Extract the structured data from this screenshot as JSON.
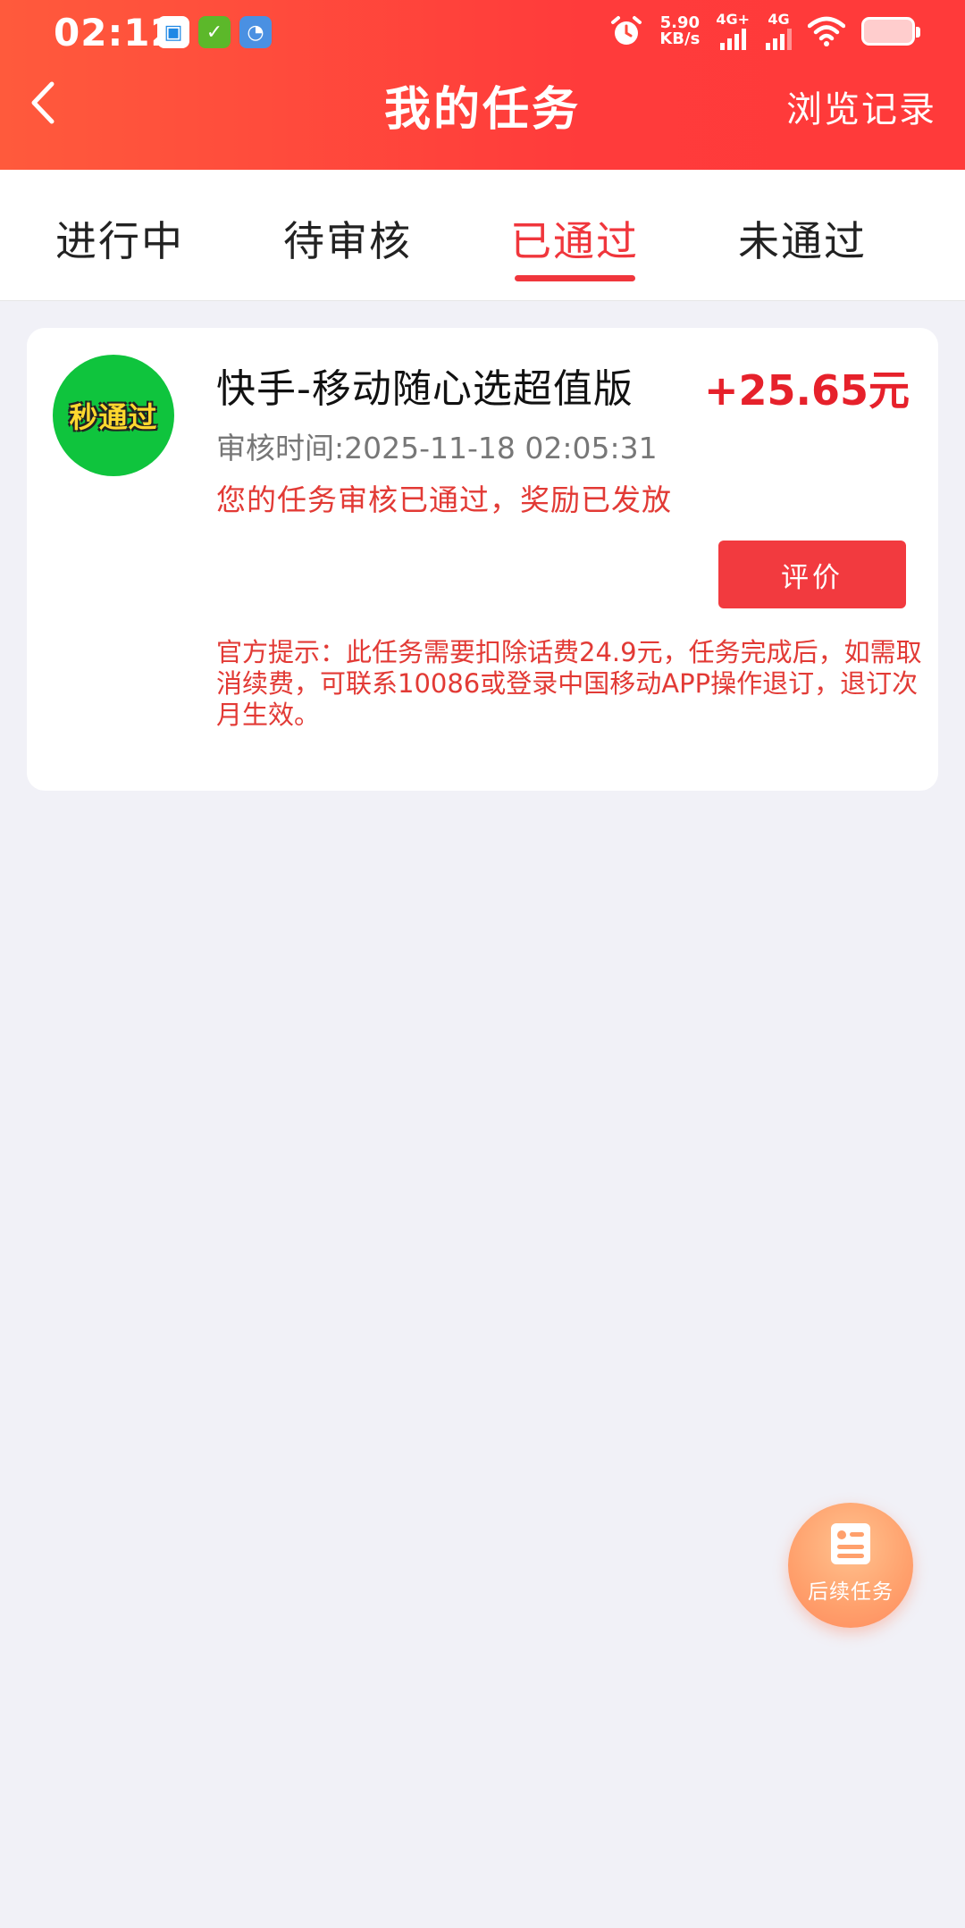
{
  "status_bar": {
    "time": "02:12",
    "net_speed_value": "5.90",
    "net_speed_unit": "KB/s",
    "sim1": "4G+",
    "sim2": "4G",
    "notif_icons": [
      "message-app-icon",
      "check-app-icon",
      "file-app-icon"
    ]
  },
  "nav": {
    "title": "我的任务",
    "right_label": "浏览记录"
  },
  "tabs": [
    {
      "label": "进行中",
      "active": false
    },
    {
      "label": "待审核",
      "active": false
    },
    {
      "label": "已通过",
      "active": true
    },
    {
      "label": "未通过",
      "active": false
    }
  ],
  "task": {
    "badge_text": "秒通过",
    "title": "快手-移动随心选超值版",
    "reward": "+25.65元",
    "review_time": "审核时间:2025-11-18 02:05:31",
    "status_msg": "您的任务审核已通过，奖励已发放",
    "rate_label": "评价",
    "tip": "官方提示：此任务需要扣除话费24.9元，任务完成后，如需取消续费，可联系10086或登录中国移动APP操作退订，退订次月生效。"
  },
  "float": {
    "label": "后续任务"
  },
  "colors": {
    "header": "#ff3b3b",
    "accent": "#f0363c",
    "badge_green": "#0fc43d",
    "float_orange": "#ffa06c"
  }
}
